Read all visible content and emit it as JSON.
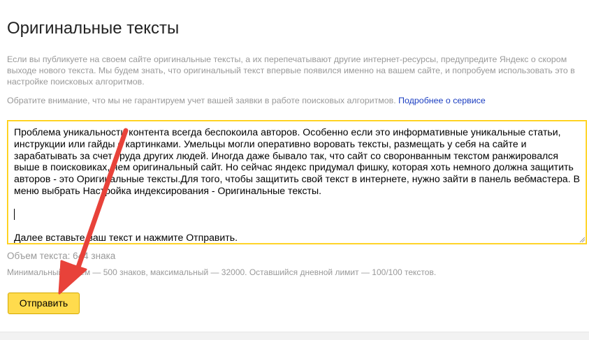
{
  "page": {
    "title": "Оригинальные тексты",
    "intro": "Если вы публикуете на своем сайте оригинальные тексты, а их перепечатывают другие интернет-ресурсы, предупредите Яндекс о скором выходе нового текста. Мы будем знать, что оригинальный текст впервые появился именно на вашем сайте, и попробуем использовать это в настройке поисковых алгоритмов.",
    "notice": "Обратите внимание, что мы не гарантируем учет вашей заявки в работе поисковых алгоритмов.",
    "notice_link": "Подробнее о сервисе"
  },
  "editor": {
    "paragraph1": "Проблема уникальности контента всегда беспокоила авторов. Особенно если это информативные уникальные статьи, инструкции или гайды с картинками. Умельцы могли оперативно воровать тексты, размещать у себя на сайте и зарабатывать за счет труда других людей. Иногда даже бывало так, что сайт со своронванным текстом ранжировался выше в поисковиках, чем оригинальный сайт. Но сейчас яндекс придумал фишку, которая хоть немного должна защитить авторов - это Оригинальные тексты.Для того, чтобы защитить свой текст в интернете, нужно зайти в панель вебмастера. В меню выбрать Настройка индексирования - Оригинальные тексты.",
    "paragraph2": "Далее вставьте ваш текст и нажмите Отправить."
  },
  "counter": {
    "text": "Объем текста: 644 знака"
  },
  "limits": {
    "text": "Минимальный объем — 500 знаков, максимальный — 32000. Оставшийся дневной лимит — 100/100 текстов."
  },
  "actions": {
    "submit_label": "Отправить"
  },
  "colors": {
    "accent": "#ffdb4d",
    "link": "#1a3dc1",
    "muted_text": "#999999",
    "annotation_arrow": "#e8423a"
  },
  "annotation": {
    "icon": "red-arrow-icon"
  }
}
